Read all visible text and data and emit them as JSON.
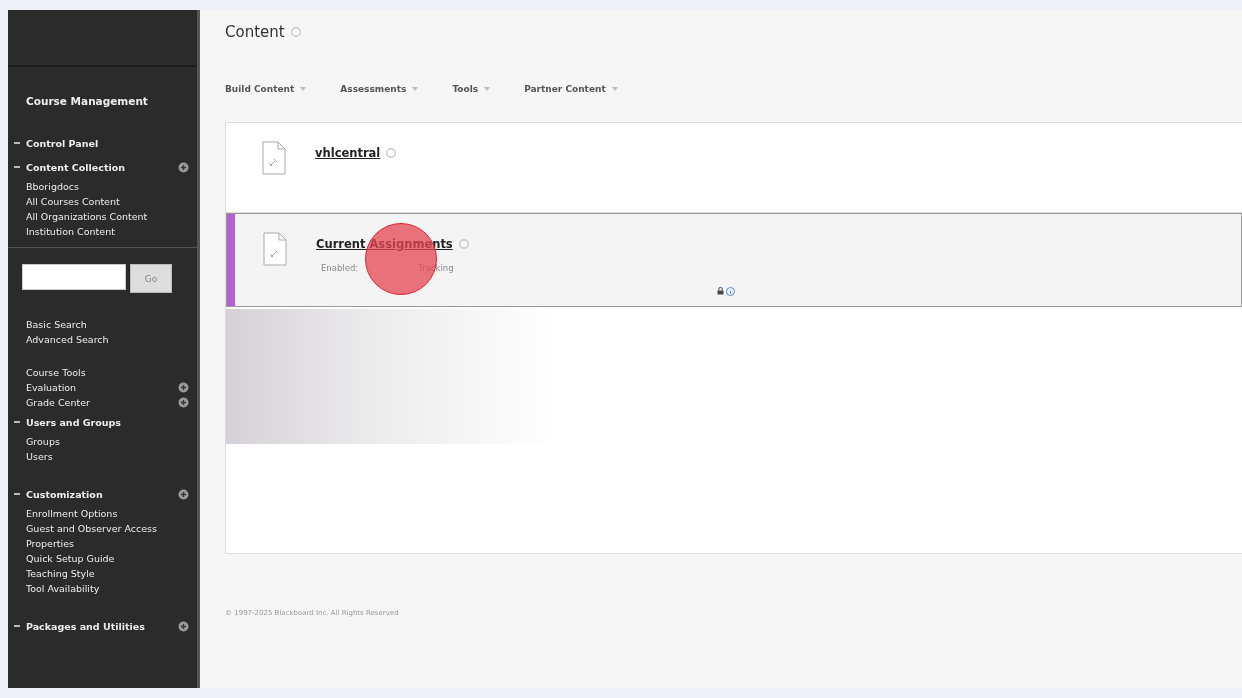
{
  "sidebar": {
    "sections": [
      {
        "items": [
          {
            "label": "Course Management",
            "kind": "heading",
            "expanded": false,
            "action": false
          }
        ]
      },
      {
        "items": [
          {
            "label": "Control Panel",
            "kind": "section",
            "expanded": true,
            "action": false
          },
          {
            "label": "Content Collection",
            "kind": "section",
            "expanded": true,
            "action": true
          },
          {
            "label": "Bborigdocs",
            "kind": "link",
            "expanded": false,
            "action": false
          },
          {
            "label": "All Courses Content",
            "kind": "link",
            "expanded": false,
            "action": false
          },
          {
            "label": "All Organizations Content",
            "kind": "link",
            "expanded": false,
            "action": false
          },
          {
            "label": "Institution Content",
            "kind": "link",
            "expanded": false,
            "action": false
          }
        ]
      },
      {
        "items": [
          {
            "label": "Basic Search",
            "kind": "link",
            "expanded": false,
            "action": false
          },
          {
            "label": "Advanced Search",
            "kind": "link",
            "expanded": false,
            "action": false
          }
        ]
      },
      {
        "items": [
          {
            "label": "Course Tools",
            "kind": "link",
            "expanded": false,
            "action": false
          },
          {
            "label": "Evaluation",
            "kind": "link",
            "expanded": false,
            "action": true
          },
          {
            "label": "Grade Center",
            "kind": "link",
            "expanded": false,
            "action": true
          },
          {
            "label": "Users and Groups",
            "kind": "section",
            "expanded": true,
            "action": false
          },
          {
            "label": "Groups",
            "kind": "link",
            "expanded": false,
            "action": false
          },
          {
            "label": "Users",
            "kind": "link",
            "expanded": false,
            "action": false
          }
        ]
      },
      {
        "items": [
          {
            "label": "Customization",
            "kind": "section",
            "expanded": true,
            "action": true
          },
          {
            "label": "Enrollment Options",
            "kind": "link",
            "expanded": false,
            "action": false
          },
          {
            "label": "Guest and Observer Access",
            "kind": "link",
            "expanded": false,
            "action": false
          },
          {
            "label": "Properties",
            "kind": "link",
            "expanded": false,
            "action": false
          },
          {
            "label": "Quick Setup Guide",
            "kind": "link",
            "expanded": false,
            "action": false
          },
          {
            "label": "Teaching Style",
            "kind": "link",
            "expanded": false,
            "action": false
          },
          {
            "label": "Tool Availability",
            "kind": "link",
            "expanded": false,
            "action": false
          }
        ]
      },
      {
        "items": [
          {
            "label": "Packages and Utilities",
            "kind": "section",
            "expanded": true,
            "action": true
          }
        ]
      }
    ],
    "search": {
      "button": "Go"
    }
  },
  "content": {
    "title": "Content",
    "actions": [
      "Build Content",
      "Assessments",
      "Tools",
      "Partner Content"
    ],
    "items": [
      {
        "title": "vhlcentral",
        "selected": false
      },
      {
        "title": "Current Assignments",
        "selected": true,
        "details": [
          "Enabled:",
          "Tracking"
        ]
      }
    ],
    "footer": "© 1997-2025 Blackboard Inc. All Rights Reserved"
  }
}
